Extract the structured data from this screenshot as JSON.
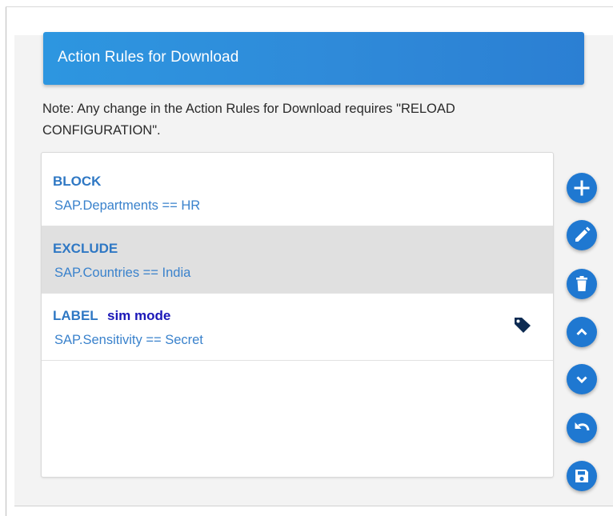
{
  "panel": {
    "title": "Action Rules for Download",
    "note": "Note: Any change in the Action Rules for Download requires \"RELOAD CONFIGURATION\"."
  },
  "rules": [
    {
      "action": "BLOCK",
      "condition": "SAP.Departments == HR",
      "selected": false
    },
    {
      "action": "EXCLUDE",
      "condition": "SAP.Countries == India",
      "selected": true
    },
    {
      "action": "LABEL",
      "mode": "sim mode",
      "condition": "SAP.Sensitivity == Secret",
      "icon": "tag-icon",
      "selected": false
    }
  ],
  "toolbar": {
    "buttons": [
      {
        "name": "add-rule-button",
        "icon": "plus-icon"
      },
      {
        "name": "edit-rule-button",
        "icon": "pencil-icon"
      },
      {
        "name": "delete-rule-button",
        "icon": "trash-icon"
      },
      {
        "name": "move-up-button",
        "icon": "chevron-up-icon"
      },
      {
        "name": "move-down-button",
        "icon": "chevron-down-icon"
      },
      {
        "name": "undo-button",
        "icon": "undo-icon"
      },
      {
        "name": "save-button",
        "icon": "save-icon"
      }
    ]
  },
  "colors": {
    "header": "#2b8ad8",
    "fab": "#1f78d1",
    "rule_action": "#2f78c4",
    "sim_mode": "#1b17b8",
    "selected_row": "#e0e0e0"
  }
}
